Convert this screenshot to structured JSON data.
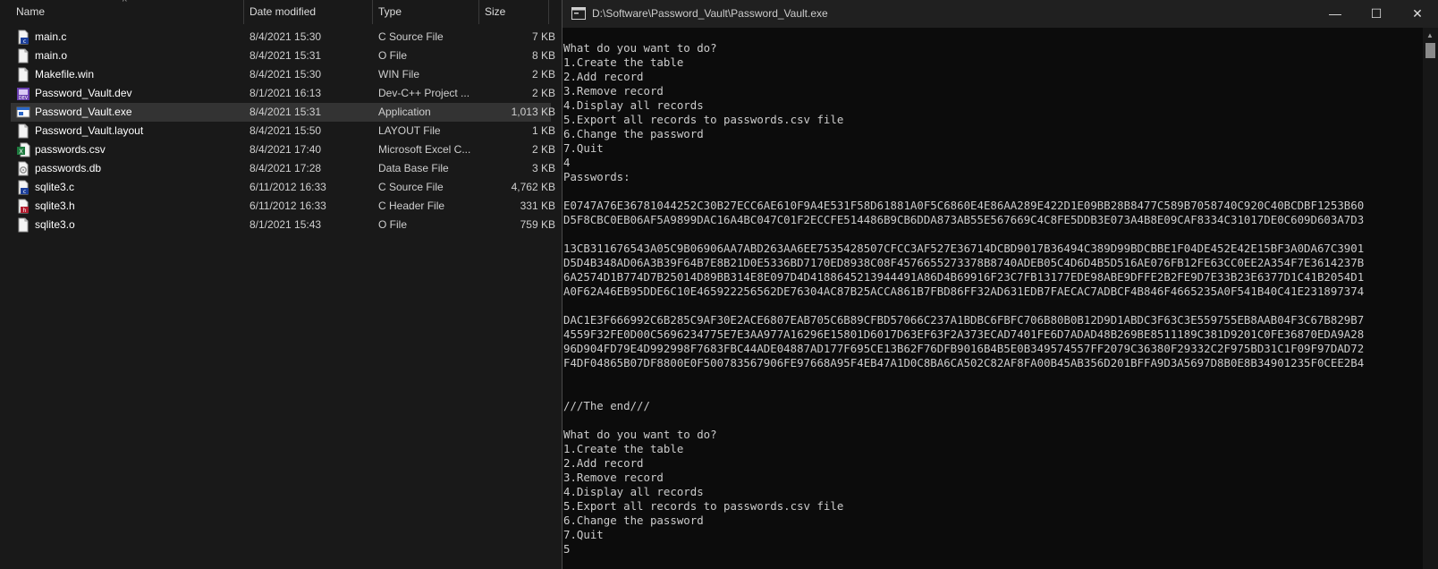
{
  "explorer": {
    "columns": {
      "name": "Name",
      "date": "Date modified",
      "type": "Type",
      "size": "Size"
    },
    "files": [
      {
        "name": "main.c",
        "date": "8/4/2021 15:30",
        "type": "C Source File",
        "size": "7 KB",
        "icon": "c-source-icon"
      },
      {
        "name": "main.o",
        "date": "8/4/2021 15:31",
        "type": "O File",
        "size": "8 KB",
        "icon": "blank-file-icon"
      },
      {
        "name": "Makefile.win",
        "date": "8/4/2021 15:30",
        "type": "WIN File",
        "size": "2 KB",
        "icon": "blank-file-icon"
      },
      {
        "name": "Password_Vault.dev",
        "date": "8/1/2021 16:13",
        "type": "Dev-C++ Project ...",
        "size": "2 KB",
        "icon": "devcpp-project-icon"
      },
      {
        "name": "Password_Vault.exe",
        "date": "8/4/2021 15:31",
        "type": "Application",
        "size": "1,013 KB",
        "icon": "application-icon"
      },
      {
        "name": "Password_Vault.layout",
        "date": "8/4/2021 15:50",
        "type": "LAYOUT File",
        "size": "1 KB",
        "icon": "blank-file-icon"
      },
      {
        "name": "passwords.csv",
        "date": "8/4/2021 17:40",
        "type": "Microsoft Excel C...",
        "size": "2 KB",
        "icon": "excel-csv-icon"
      },
      {
        "name": "passwords.db",
        "date": "8/4/2021 17:28",
        "type": "Data Base File",
        "size": "3 KB",
        "icon": "database-file-icon"
      },
      {
        "name": "sqlite3.c",
        "date": "6/11/2012 16:33",
        "type": "C Source File",
        "size": "4,762 KB",
        "icon": "c-source-icon"
      },
      {
        "name": "sqlite3.h",
        "date": "6/11/2012 16:33",
        "type": "C Header File",
        "size": "331 KB",
        "icon": "c-header-icon"
      },
      {
        "name": "sqlite3.o",
        "date": "8/1/2021 15:43",
        "type": "O File",
        "size": "759 KB",
        "icon": "blank-file-icon"
      }
    ],
    "selected_index": 4
  },
  "console": {
    "title": "D:\\Software\\Password_Vault\\Password_Vault.exe",
    "minimize": "—",
    "maximize": "☐",
    "close": "✕",
    "lines": [
      "What do you want to do?",
      "1.Create the table",
      "2.Add record",
      "3.Remove record",
      "4.Display all records",
      "5.Export all records to passwords.csv file",
      "6.Change the password",
      "7.Quit",
      "4",
      "Passwords:",
      "",
      "E0747A76E36781044252C30B27ECC6AE610F9A4E531F58D61881A0F5C6860E4E86AA289E422D1E09BB28B8477C589B7058740C920C40BCDBF1253B60",
      "D5F8CBC0EB06AF5A9899DAC16A4BC047C01F2ECCFE514486B9CB6DDA873AB55E567669C4C8FE5DDB3E073A4B8E09CAF8334C31017DE0C609D603A7D3",
      "",
      "13CB311676543A05C9B06906AA7ABD263AA6EE7535428507CFCC3AF527E36714DCBD9017B36494C389D99BDCBBE1F04DE452E42E15BF3A0DA67C3901",
      "D5D4B348AD06A3B39F64B7E8B21D0E5336BD7170ED8938C08F4576655273378B8740ADEB05C4D6D4B5D516AE076FB12FE63CC0EE2A354F7E3614237B",
      "6A2574D1B774D7B25014D89BB314E8E097D4D4188645213944491A86D4B69916F23C7FB13177EDE98ABE9DFFE2B2FE9D7E33B23E6377D1C41B2054D1",
      "A0F62A46EB95DDE6C10E465922256562DE76304AC87B25ACCA861B7FBD86FF32AD631EDB7FAECAC7ADBCF4B846F4665235A0F541B40C41E231897374",
      "",
      "DAC1E3F666992C6B285C9AF30E2ACE6807EAB705C6B89CFBD57066C237A1BDBC6FBFC706B80B0B12D9D1ABDC3F63C3E559755EB8AAB04F3C67B829B7",
      "4559F32FE0D00C5696234775E7E3AA977A16296E15801D6017D63EF63F2A373ECAD7401FE6D7ADAD48B269BE8511189C381D9201C0FE36870EDA9A28",
      "96D904FD79E4D992998F7683FBC44ADE04887AD177F695CE13B62F76DFB9016B4B5E0B349574557FF2079C36380F29332C2F975BD31C1F09F97DAD72",
      "F4DF04865B07DF8800E0F500783567906FE97668A95F4EB47A1D0C8BA6CA502C82AF8FA00B45AB356D201BFFA9D3A5697D8B0E8B34901235F0CEE2B4",
      "",
      "",
      "///The end///",
      "",
      "What do you want to do?",
      "1.Create the table",
      "2.Add record",
      "3.Remove record",
      "4.Display all records",
      "5.Export all records to passwords.csv file",
      "6.Change the password",
      "7.Quit",
      "5"
    ]
  }
}
